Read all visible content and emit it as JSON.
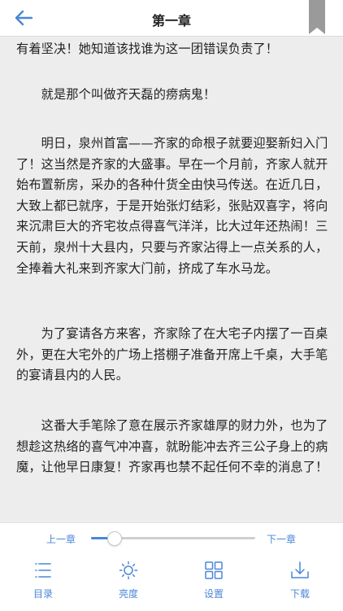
{
  "header": {
    "title": "第一章",
    "back_icon": "back-arrow-icon",
    "bookmark_icon": "bookmark-icon"
  },
  "content": {
    "paragraphs": [
      "有着坚决！她知道该找谁为这一团错误负责了！",
      "　　就是那个叫做齐天磊的痨病鬼！",
      "　　明日，泉州首富——齐家的命根子就要迎娶新妇入门了！这当然是齐家的大盛事。早在一个月前，齐家人就开始布置新房，采办的各种什货全由快马传送。在近几日，大致上都已就序，于是开始张灯结彩，张贴双喜字，将向来沉肃巨大的齐宅妆点得喜气洋洋，比大过年还热闹！三天前，泉州十大县内，只要与齐家沾得上一点关系的人，全捧着大礼来到齐家大门前，挤成了车水马龙。",
      "　　为了宴请各方来客，齐家除了在大宅子内摆了一百桌外，更在大宅外的广场上搭棚子准备开席上千桌，大手笔的宴请县内的人民。",
      "　　这番大手笔除了意在展示齐家雄厚的财力外，也为了想趁这热络的喜气冲冲喜，就盼能冲去齐三公子身上的病魔，让他早日康复！齐家再也禁不起任何不幸的消息了！"
    ]
  },
  "reader_controls": {
    "prev_chapter": "上一章",
    "next_chapter": "下一章",
    "progress": 0.14,
    "toolbar": [
      {
        "label": "目录",
        "icon": "list-icon"
      },
      {
        "label": "亮度",
        "icon": "sun-icon"
      },
      {
        "label": "设置",
        "icon": "grid-icon"
      },
      {
        "label": "下载",
        "icon": "download-icon"
      }
    ]
  },
  "colors": {
    "accent": "#4a86d8",
    "page_background": "#ededed",
    "text": "#222222"
  }
}
